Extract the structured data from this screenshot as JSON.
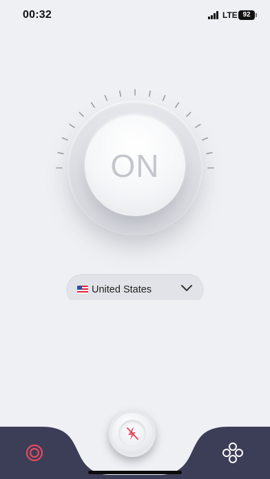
{
  "status_bar": {
    "time": "00:32",
    "network": "LTE",
    "battery": "92"
  },
  "connection": {
    "state_label": "ON"
  },
  "server": {
    "country": "United States",
    "flag": "us-flag-icon"
  },
  "bottom_nav": {
    "left_icon": "target-icon",
    "center_icon": "speed-boost-icon",
    "right_icon": "servers-icon"
  },
  "colors": {
    "accent": "#e84a5f",
    "nav_bg": "#3c3d57",
    "background": "#eff0f4"
  }
}
